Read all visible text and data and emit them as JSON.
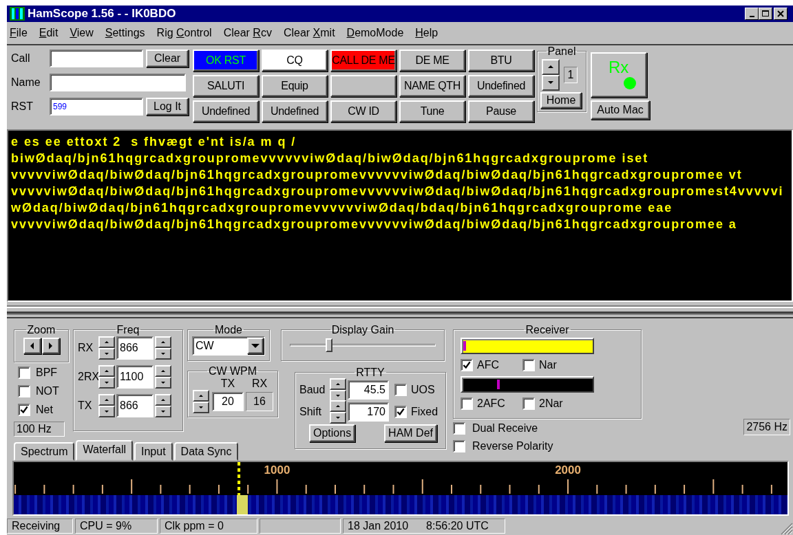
{
  "window": {
    "title": "HamScope 1.56 - - IK0BDO"
  },
  "menu": [
    {
      "key": "F",
      "post": "ile"
    },
    {
      "key": "E",
      "post": "dit"
    },
    {
      "key": "V",
      "post": "iew"
    },
    {
      "key": "S",
      "post": "ettings"
    },
    {
      "pre": "Rig ",
      "key": "C",
      "post": "ontrol"
    },
    {
      "pre": "Clear ",
      "key": "R",
      "post": "cv"
    },
    {
      "pre": "Clear ",
      "key": "X",
      "post": "mit"
    },
    {
      "key": "D",
      "post": "emoMode"
    },
    {
      "key": "H",
      "post": "elp"
    }
  ],
  "qso": {
    "call_label": "Call",
    "name_label": "Name",
    "rst_label": "RST",
    "rst_value": "599",
    "clear_button": "Clear",
    "log_button": "Log It"
  },
  "macros": [
    {
      "kind": "signal",
      "label": "OK RST",
      "color": "#0000ff"
    },
    {
      "kind": "plain",
      "label": "CQ",
      "color": "#ffffff"
    },
    {
      "kind": "plain",
      "label": "CALL DE ME",
      "color": "#ff0000"
    },
    {
      "kind": "plain",
      "label": "DE ME"
    },
    {
      "kind": "plain",
      "label": "BTU"
    },
    {
      "kind": "plain",
      "label": "SALUTI"
    },
    {
      "kind": "plain",
      "label": "Equip"
    },
    {
      "kind": "blank"
    },
    {
      "kind": "plain",
      "label": "NAME QTH"
    },
    {
      "kind": "plain",
      "label": "Undefined"
    },
    {
      "kind": "plain",
      "label": "Undefined"
    },
    {
      "kind": "plain",
      "label": "Undefined"
    },
    {
      "kind": "plain",
      "label": "CW ID"
    },
    {
      "kind": "plain",
      "label": "Tune"
    },
    {
      "kind": "plain",
      "label": "Pause"
    }
  ],
  "panel": {
    "title": "Panel",
    "number": "1",
    "home": "Home"
  },
  "rx_button": {
    "label": "Rx",
    "on": true
  },
  "auto_mac": "Auto Mac",
  "receive_text": [
    "e es ee ettoxt 2  s fhvægt e'nt is/a m q /",
    "biwØdaq/bjn61hqgrcadxgroupromevvvvvviwØdaq/biwØdaq/bjn61hqgrcadxgrouprome iset",
    "vvvvviwØdaq/biwØdaq/bjn61hqgrcadxgroupromevvvvvviwØdaq/biwØdaq/bjn61hqgrcadxgroupromee vt",
    "vvvvviwØdaq/biwØdaq/bjn61hqgrcadxgroupromevvvvvviwØdaq/biwØdaq/bjn61hqgrcadxgroupromest4vvvvvi",
    "wØdaq/biwØdaq/bjn61hqgrcadxgroupromevvvvvviwØdaq/bdaq/bjn61hqgrcadxgrouprome eae",
    "vvvvviwØdaq/biwØdaq/bjn61hqgrcadxgroupromevvvvvviwØdaq/biwØdaq/bjn61hqgrcadxgroupromee a"
  ],
  "controls": {
    "zoom": {
      "title": "Zoom"
    },
    "filters": [
      {
        "label": "BPF",
        "checked": false
      },
      {
        "label": "NOT",
        "checked": false
      },
      {
        "label": "Net",
        "checked": true
      }
    ],
    "zoom_readout": "100 Hz",
    "freq": {
      "title": "Freq",
      "rows": [
        {
          "label": "RX",
          "value": "866"
        },
        {
          "label": "2RX",
          "value": "1100"
        },
        {
          "label": "TX",
          "value": "866"
        }
      ]
    },
    "mode": {
      "title": "Mode",
      "value": "CW"
    },
    "cw_wpm": {
      "title": "CW WPM",
      "tx_label": "TX",
      "rx_label": "RX",
      "tx": "20",
      "rx": "16"
    },
    "display_gain": {
      "title": "Display Gain",
      "level": 0.27
    },
    "rtty": {
      "title": "RTTY",
      "rows": [
        {
          "label": "Baud",
          "value": "45.5",
          "option": {
            "label": "UOS",
            "checked": false
          }
        },
        {
          "label": "Shift",
          "value": "170",
          "option": {
            "label": "Fixed",
            "checked": true
          }
        }
      ],
      "buttons": [
        "Options",
        "HAM Def"
      ]
    },
    "receiver": {
      "title": "Receiver",
      "checks": [
        {
          "label": "AFC",
          "checked": true
        },
        {
          "label": "Nar",
          "checked": false
        }
      ],
      "checks2": [
        {
          "label": "2AFC",
          "checked": false
        },
        {
          "label": "2Nar",
          "checked": false
        }
      ]
    },
    "extra_checks": [
      {
        "label": "Dual Receive",
        "checked": false
      },
      {
        "label": "Reverse Polarity",
        "checked": false
      }
    ],
    "freq_readout": "2756 Hz"
  },
  "tabs": [
    {
      "label": "Spectrum",
      "selected": false
    },
    {
      "label": "Waterfall",
      "selected": true
    },
    {
      "label": "Input",
      "selected": false
    },
    {
      "label": "Data Sync",
      "selected": false
    }
  ],
  "waterfall": {
    "scale_labels": [
      "1000",
      "2000"
    ]
  },
  "status_bar": [
    {
      "kind": "text",
      "texts": [
        "Receiving"
      ]
    },
    {
      "kind": "text",
      "texts": [
        "CPU = 9%"
      ]
    },
    {
      "kind": "text",
      "texts": [
        "Clk ppm = 0"
      ]
    },
    {
      "kind": "blank"
    },
    {
      "kind": "text",
      "texts": [
        "18 Jan 2010",
        "8:56:20 UTC"
      ]
    }
  ]
}
